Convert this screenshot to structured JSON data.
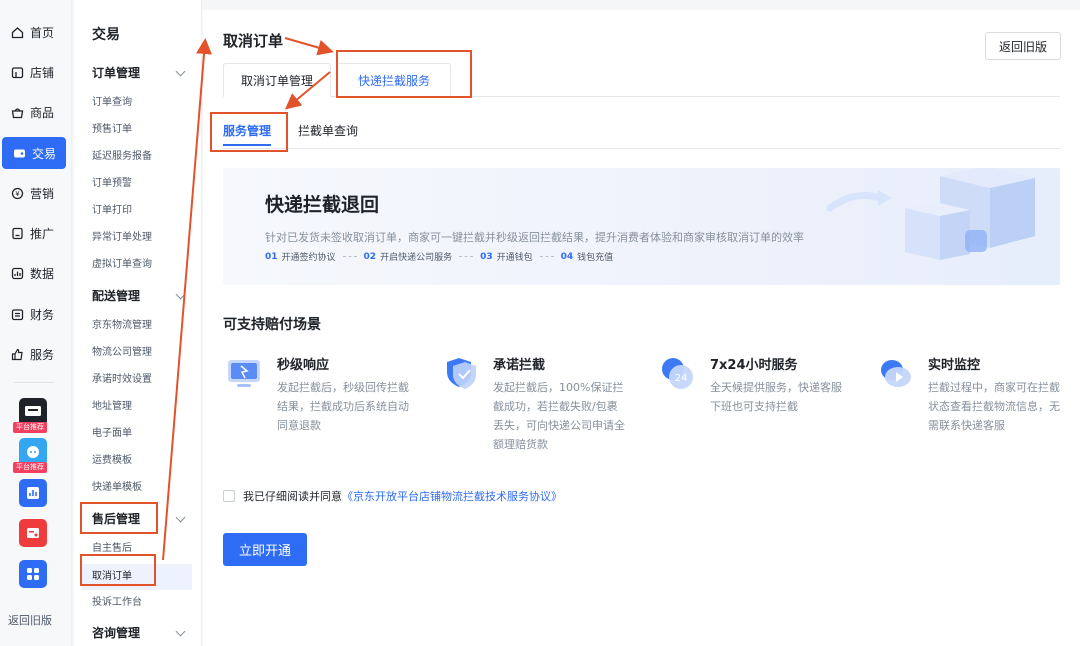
{
  "rail": {
    "items": [
      {
        "label": "首页",
        "icon": "home-icon"
      },
      {
        "label": "店铺",
        "icon": "store-icon"
      },
      {
        "label": "商品",
        "icon": "basket-icon"
      },
      {
        "label": "交易",
        "icon": "trade-icon",
        "active": true
      },
      {
        "label": "营销",
        "icon": "marketing-icon"
      },
      {
        "label": "推广",
        "icon": "promote-icon"
      },
      {
        "label": "数据",
        "icon": "data-icon"
      },
      {
        "label": "财务",
        "icon": "finance-icon"
      },
      {
        "label": "服务",
        "icon": "service-icon"
      }
    ],
    "apps": [
      {
        "name": "传韦打印",
        "badge": "平台推荐"
      },
      {
        "name": "咚咚助手",
        "badge": "平台推荐"
      }
    ],
    "back_label": "返回旧版"
  },
  "menu": {
    "title": "交易",
    "groups": [
      {
        "label": "订单管理",
        "items": [
          "订单查询",
          "预售订单",
          "延迟服务报备",
          "订单预警",
          "订单打印",
          "异常订单处理",
          "虚拟订单查询"
        ]
      },
      {
        "label": "配送管理",
        "items": [
          "京东物流管理",
          "物流公司管理",
          "承诺时效设置",
          "地址管理",
          "电子面单",
          "运费模板",
          "快递单模板"
        ]
      },
      {
        "label": "售后管理",
        "items": [
          "自主售后",
          "取消订单",
          "投诉工作台"
        ]
      },
      {
        "label": "咨询管理",
        "items": []
      }
    ],
    "active_item": "取消订单"
  },
  "main": {
    "title": "取消订单",
    "back_old_label": "返回旧版",
    "tabs": [
      "取消订单管理",
      "快递拦截服务"
    ],
    "active_tab": "快递拦截服务",
    "subtabs": [
      "服务管理",
      "拦截单查询"
    ],
    "active_subtab": "服务管理",
    "banner": {
      "title": "快递拦截退回",
      "desc": "针对已发货未签收取消订单，商家可一键拦截并秒级返回拦截结果，提升消费者体验和商家审核取消订单的效率",
      "steps": [
        {
          "num": "01",
          "label": "开通签约协议"
        },
        {
          "num": "02",
          "label": "开启快递公司服务"
        },
        {
          "num": "03",
          "label": "开通钱包"
        },
        {
          "num": "04",
          "label": "钱包充值"
        }
      ]
    },
    "section_title": "可支持赔付场景",
    "features": [
      {
        "name": "秒级响应",
        "desc": "发起拦截后，秒级回传拦截结果，拦截成功后系统自动同意退款"
      },
      {
        "name": "承诺拦截",
        "desc": "发起拦截后，100%保证拦截成功，若拦截失败/包裹丢失，可向快递公司申请全额理赔货款"
      },
      {
        "name": "7x24小时服务",
        "desc": "全天候提供服务，快递客服下班也可支持拦截"
      },
      {
        "name": "实时监控",
        "desc": "拦截过程中，商家可在拦截状态查看拦截物流信息，无需联系快递客服"
      }
    ],
    "agree_text": "我已仔细阅读并同意",
    "agree_link": "《京东开放平台店铺物流拦截技术服务协议》",
    "submit_label": "立即开通"
  },
  "colors": {
    "primary": "#2f6cf6",
    "annotation": "#e3532b"
  }
}
